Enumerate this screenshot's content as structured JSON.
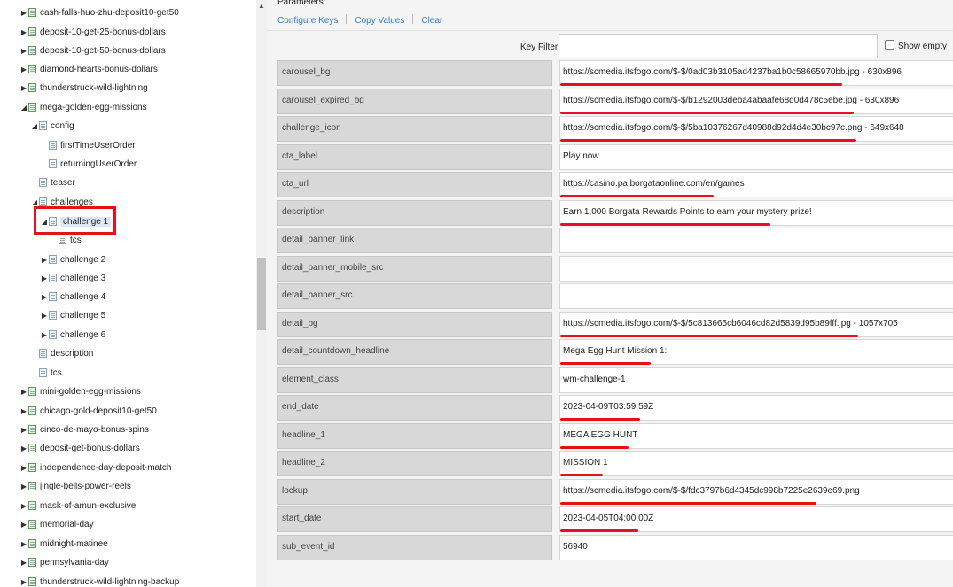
{
  "tree": {
    "items": [
      {
        "label": "cash-falls-huo-zhu-deposit10-get50",
        "arrow": "▶",
        "icon": "g"
      },
      {
        "label": "deposit-10-get-25-bonus-dollars",
        "arrow": "▶",
        "icon": "g"
      },
      {
        "label": "deposit-10-get-50-bonus-dollars",
        "arrow": "▶",
        "icon": "g"
      },
      {
        "label": "diamond-hearts-bonus-dollars",
        "arrow": "▶",
        "icon": "g"
      },
      {
        "label": "thunderstruck-wild-lightning",
        "arrow": "▶",
        "icon": "g"
      },
      {
        "label": "mega-golden-egg-missions",
        "arrow": "◢",
        "icon": "g"
      },
      {
        "label": "config",
        "arrow": "◢",
        "icon": "b"
      },
      {
        "label": "firstTimeUserOrder",
        "arrow": "",
        "icon": "b"
      },
      {
        "label": "returningUserOrder",
        "arrow": "",
        "icon": "b"
      },
      {
        "label": "teaser",
        "arrow": "",
        "icon": "b"
      },
      {
        "label": "challenges",
        "arrow": "◢",
        "icon": "b"
      },
      {
        "label": "challenge 1",
        "arrow": "◢",
        "icon": "b",
        "selected": true
      },
      {
        "label": "tcs",
        "arrow": "",
        "icon": "b"
      },
      {
        "label": "challenge 2",
        "arrow": "▶",
        "icon": "b"
      },
      {
        "label": "challenge 3",
        "arrow": "▶",
        "icon": "b"
      },
      {
        "label": "challenge 4",
        "arrow": "▶",
        "icon": "b"
      },
      {
        "label": "challenge 5",
        "arrow": "▶",
        "icon": "b"
      },
      {
        "label": "challenge 6",
        "arrow": "▶",
        "icon": "b"
      },
      {
        "label": "description",
        "arrow": "",
        "icon": "b"
      },
      {
        "label": "tcs",
        "arrow": "",
        "icon": "b"
      },
      {
        "label": "mini-golden-egg-missions",
        "arrow": "▶",
        "icon": "g"
      },
      {
        "label": "chicago-gold-deposit10-get50",
        "arrow": "▶",
        "icon": "g"
      },
      {
        "label": "cinco-de-mayo-bonus-spins",
        "arrow": "▶",
        "icon": "g"
      },
      {
        "label": "deposit-get-bonus-dollars",
        "arrow": "▶",
        "icon": "g"
      },
      {
        "label": "independence-day-deposit-match",
        "arrow": "▶",
        "icon": "g"
      },
      {
        "label": "jingle-bells-power-reels",
        "arrow": "▶",
        "icon": "g"
      },
      {
        "label": "mask-of-amun-exclusive",
        "arrow": "▶",
        "icon": "g"
      },
      {
        "label": "memorial-day",
        "arrow": "▶",
        "icon": "g"
      },
      {
        "label": "midnight-matinee",
        "arrow": "▶",
        "icon": "g"
      },
      {
        "label": "pennsylvania-day",
        "arrow": "▶",
        "icon": "g"
      },
      {
        "label": "thunderstruck-wild-lightning-backup",
        "arrow": "▶",
        "icon": "g"
      }
    ]
  },
  "panel": {
    "title": "Parameters:",
    "links": {
      "configure": "Configure Keys",
      "copy": "Copy Values",
      "clear": "Clear"
    },
    "key_filter_label": "Key Filter:",
    "key_filter_value": "",
    "show_empty_label": "Show empty",
    "rows": [
      {
        "key": "carousel_bg",
        "value": "https://scmedia.itsfogo.com/$-$/0ad03b3105ad4237ba1b0c58665970bb.jpg   -   630x896"
      },
      {
        "key": "carousel_expired_bg",
        "value": "https://scmedia.itsfogo.com/$-$/b1292003deba4abaafe68d0d478c5ebe.jpg   -   630x896"
      },
      {
        "key": "challenge_icon",
        "value": "https://scmedia.itsfogo.com/$-$/5ba10376267d40988d92d4d4e30bc97c.png   -   649x648"
      },
      {
        "key": "cta_label",
        "value": "Play now"
      },
      {
        "key": "cta_url",
        "value": "https://casino.pa.borgataonline.com/en/games"
      },
      {
        "key": "description",
        "value": "Earn 1,000 Borgata Rewards Points to earn your mystery prize!"
      },
      {
        "key": "detail_banner_link",
        "value": ""
      },
      {
        "key": "detail_banner_mobile_src",
        "value": ""
      },
      {
        "key": "detail_banner_src",
        "value": ""
      },
      {
        "key": "detail_bg",
        "value": "https://scmedia.itsfogo.com/$-$/5c813665cb6046cd82d5839d95b89fff.jpg   -   1057x705"
      },
      {
        "key": "detail_countdown_headline",
        "value": "Mega Egg Hunt Mission 1:"
      },
      {
        "key": "element_class",
        "value": "wm-challenge-1"
      },
      {
        "key": "end_date",
        "value": "2023-04-09T03:59:59Z"
      },
      {
        "key": "headline_1",
        "value": "MEGA EGG HUNT"
      },
      {
        "key": "headline_2",
        "value": "MISSION 1"
      },
      {
        "key": "lockup",
        "value": "https://scmedia.itsfogo.com/$-$/fdc3797b6d4345dc998b7225e2639e69.png"
      },
      {
        "key": "start_date",
        "value": "2023-04-05T04:00:00Z"
      },
      {
        "key": "sub_event_id",
        "value": "56940"
      }
    ]
  },
  "colors": {
    "annotation_red": "#e8101a",
    "link": "#3b7dc4",
    "selection": "#dbe8f6"
  }
}
